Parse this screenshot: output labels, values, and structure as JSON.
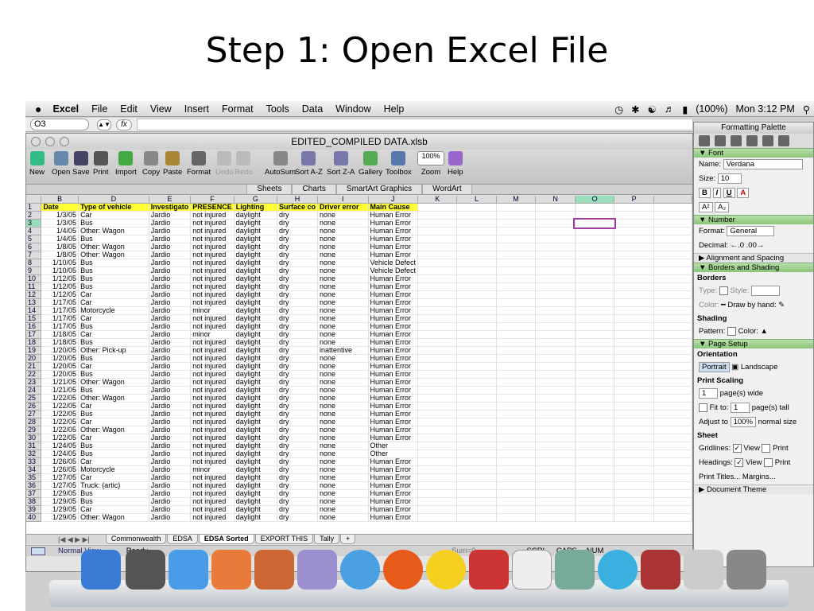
{
  "slide_title": "Step 1: Open Excel File",
  "menubar": {
    "app": "Excel",
    "items": [
      "File",
      "Edit",
      "View",
      "Insert",
      "Format",
      "Tools",
      "Data",
      "Window",
      "Help"
    ],
    "battery": "(100%)",
    "clock": "Mon 3:12 PM"
  },
  "formula_bar": {
    "cell_ref": "O3",
    "fx": "fx"
  },
  "window": {
    "title": "EDITED_COMPILED DATA.xlsb"
  },
  "toolbar": {
    "buttons": [
      "New",
      "Open",
      "Save",
      "Print",
      "Import",
      "Copy",
      "Paste",
      "Format",
      "Undo",
      "Redo",
      "AutoSum",
      "Sort A-Z",
      "Sort Z-A",
      "Gallery",
      "Toolbox",
      "Zoom",
      "Help"
    ],
    "zoom": "100%"
  },
  "ribbon_tabs": [
    "Sheets",
    "Charts",
    "SmartArt Graphics",
    "WordArt"
  ],
  "columns": [
    "B",
    "D",
    "E",
    "F",
    "G",
    "H",
    "I",
    "J",
    "K",
    "L",
    "M",
    "N",
    "O",
    "P"
  ],
  "header_row": [
    "Date",
    "Type of vehicle",
    "Investigato",
    "PRESENCE",
    "Lighting",
    "Surface co",
    "Driver error",
    "Main Cause"
  ],
  "rows": [
    [
      "1/3/05",
      "Car",
      "Jardio",
      "not injured",
      "daylight",
      "dry",
      "none",
      "Human Error"
    ],
    [
      "1/3/05",
      "Bus",
      "Jardio",
      "not injured",
      "daylight",
      "dry",
      "none",
      "Human Error"
    ],
    [
      "1/4/05",
      "Other: Wagon",
      "Jardio",
      "not injured",
      "daylight",
      "dry",
      "none",
      "Human Error"
    ],
    [
      "1/4/05",
      "Bus",
      "Jardio",
      "not injured",
      "daylight",
      "dry",
      "none",
      "Human Error"
    ],
    [
      "1/8/05",
      "Other: Wagon",
      "Jardio",
      "not injured",
      "daylight",
      "dry",
      "none",
      "Human Error"
    ],
    [
      "1/8/05",
      "Other: Wagon",
      "Jardio",
      "not injured",
      "daylight",
      "dry",
      "none",
      "Human Error"
    ],
    [
      "1/10/05",
      "Bus",
      "Jardio",
      "not injured",
      "daylight",
      "dry",
      "none",
      "Vehicle Defect"
    ],
    [
      "1/10/05",
      "Bus",
      "Jardio",
      "not injured",
      "daylight",
      "dry",
      "none",
      "Vehicle Defect"
    ],
    [
      "1/12/05",
      "Bus",
      "Jardio",
      "not injured",
      "daylight",
      "dry",
      "none",
      "Human Error"
    ],
    [
      "1/12/05",
      "Bus",
      "Jardio",
      "not injured",
      "daylight",
      "dry",
      "none",
      "Human Error"
    ],
    [
      "1/12/05",
      "Car",
      "Jardio",
      "not injured",
      "daylight",
      "dry",
      "none",
      "Human Error"
    ],
    [
      "1/17/05",
      "Car",
      "Jardio",
      "not injured",
      "daylight",
      "dry",
      "none",
      "Human Error"
    ],
    [
      "1/17/05",
      "Motorcycle",
      "Jardio",
      "minor",
      "daylight",
      "dry",
      "none",
      "Human Error"
    ],
    [
      "1/17/05",
      "Car",
      "Jardio",
      "not injured",
      "daylight",
      "dry",
      "none",
      "Human Error"
    ],
    [
      "1/17/05",
      "Bus",
      "Jardio",
      "not injured",
      "daylight",
      "dry",
      "none",
      "Human Error"
    ],
    [
      "1/18/05",
      "Car",
      "Jardio",
      "minor",
      "daylight",
      "dry",
      "none",
      "Human Error"
    ],
    [
      "1/18/05",
      "Bus",
      "Jardio",
      "not injured",
      "daylight",
      "dry",
      "none",
      "Human Error"
    ],
    [
      "1/20/05",
      "Other: Pick-up",
      "Jardio",
      "not injured",
      "daylight",
      "dry",
      "inattentive",
      "Human Error"
    ],
    [
      "1/20/05",
      "Bus",
      "Jardio",
      "not injured",
      "daylight",
      "dry",
      "none",
      "Human Error"
    ],
    [
      "1/20/05",
      "Car",
      "Jardio",
      "not injured",
      "daylight",
      "dry",
      "none",
      "Human Error"
    ],
    [
      "1/20/05",
      "Bus",
      "Jardio",
      "not injured",
      "daylight",
      "dry",
      "none",
      "Human Error"
    ],
    [
      "1/21/05",
      "Other: Wagon",
      "Jardio",
      "not injured",
      "daylight",
      "dry",
      "none",
      "Human Error"
    ],
    [
      "1/21/05",
      "Bus",
      "Jardio",
      "not injured",
      "daylight",
      "dry",
      "none",
      "Human Error"
    ],
    [
      "1/22/05",
      "Other: Wagon",
      "Jardio",
      "not injured",
      "daylight",
      "dry",
      "none",
      "Human Error"
    ],
    [
      "1/22/05",
      "Car",
      "Jardio",
      "not injured",
      "daylight",
      "dry",
      "none",
      "Human Error"
    ],
    [
      "1/22/05",
      "Bus",
      "Jardio",
      "not injured",
      "daylight",
      "dry",
      "none",
      "Human Error"
    ],
    [
      "1/22/05",
      "Car",
      "Jardio",
      "not injured",
      "daylight",
      "dry",
      "none",
      "Human Error"
    ],
    [
      "1/22/05",
      "Other: Wagon",
      "Jardio",
      "not injured",
      "daylight",
      "dry",
      "none",
      "Human Error"
    ],
    [
      "1/22/05",
      "Car",
      "Jardio",
      "not injured",
      "daylight",
      "dry",
      "none",
      "Human Error"
    ],
    [
      "1/24/05",
      "Bus",
      "Jardio",
      "not injured",
      "daylight",
      "dry",
      "none",
      "Other"
    ],
    [
      "1/24/05",
      "Bus",
      "Jardio",
      "not injured",
      "daylight",
      "dry",
      "none",
      "Other"
    ],
    [
      "1/26/05",
      "Car",
      "Jardio",
      "not injured",
      "daylight",
      "dry",
      "none",
      "Human Error"
    ],
    [
      "1/26/05",
      "Motorcycle",
      "Jardio",
      "minor",
      "daylight",
      "dry",
      "none",
      "Human Error"
    ],
    [
      "1/27/05",
      "Car",
      "Jardio",
      "not injured",
      "daylight",
      "dry",
      "none",
      "Human Error"
    ],
    [
      "1/27/05",
      "Truck: (artic)",
      "Jardio",
      "not injured",
      "daylight",
      "dry",
      "none",
      "Human Error"
    ],
    [
      "1/29/05",
      "Bus",
      "Jardio",
      "not injured",
      "daylight",
      "dry",
      "none",
      "Human Error"
    ],
    [
      "1/29/05",
      "Bus",
      "Jardio",
      "not injured",
      "daylight",
      "dry",
      "none",
      "Human Error"
    ],
    [
      "1/29/05",
      "Car",
      "Jardio",
      "not injured",
      "daylight",
      "dry",
      "none",
      "Human Error"
    ],
    [
      "1/29/05",
      "Other: Wagon",
      "Jardio",
      "not injured",
      "daylight",
      "dry",
      "none",
      "Human Error"
    ]
  ],
  "sheet_tabs": [
    "Commonwealth",
    "EDSA",
    "EDSA Sorted",
    "EXPORT THIS",
    "Tally"
  ],
  "active_sheet": "EDSA Sorted",
  "status": {
    "view": "Normal View",
    "state": "Ready",
    "sum": "Sum=0",
    "scrl": "SCRL",
    "caps": "CAPS",
    "num": "NUM"
  },
  "palette": {
    "title": "Formatting Palette",
    "font_section": "Font",
    "name_label": "Name:",
    "font_name": "Verdana",
    "size_label": "Size:",
    "font_size": "10",
    "number_section": "Number",
    "format_label": "Format:",
    "format_value": "General",
    "decimal_label": "Decimal:",
    "align_section": "Alignment and Spacing",
    "borders_section": "Borders and Shading",
    "borders_sub": "Borders",
    "type_label": "Type:",
    "style_label": "Style:",
    "color_label": "Color:",
    "draw_label": "Draw by hand:",
    "shading_sub": "Shading",
    "pattern_label": "Pattern:",
    "shading_color_label": "Color:",
    "page_section": "Page Setup",
    "orientation_sub": "Orientation",
    "portrait": "Portrait",
    "landscape": "Landscape",
    "scaling_sub": "Print Scaling",
    "fit_to": "Fit to:",
    "wide_val": "1",
    "wide_label": "page(s) wide",
    "tall_val": "1",
    "tall_label": "page(s) tall",
    "adjust_label": "Adjust to",
    "adjust_val": "100%",
    "normal_label": "normal size",
    "sheet_sub": "Sheet",
    "gridlines_label": "Gridlines:",
    "headings_label": "Headings:",
    "view_label": "View",
    "print_label": "Print",
    "print_titles": "Print Titles...",
    "margins": "Margins...",
    "doc_theme": "Document Theme"
  }
}
